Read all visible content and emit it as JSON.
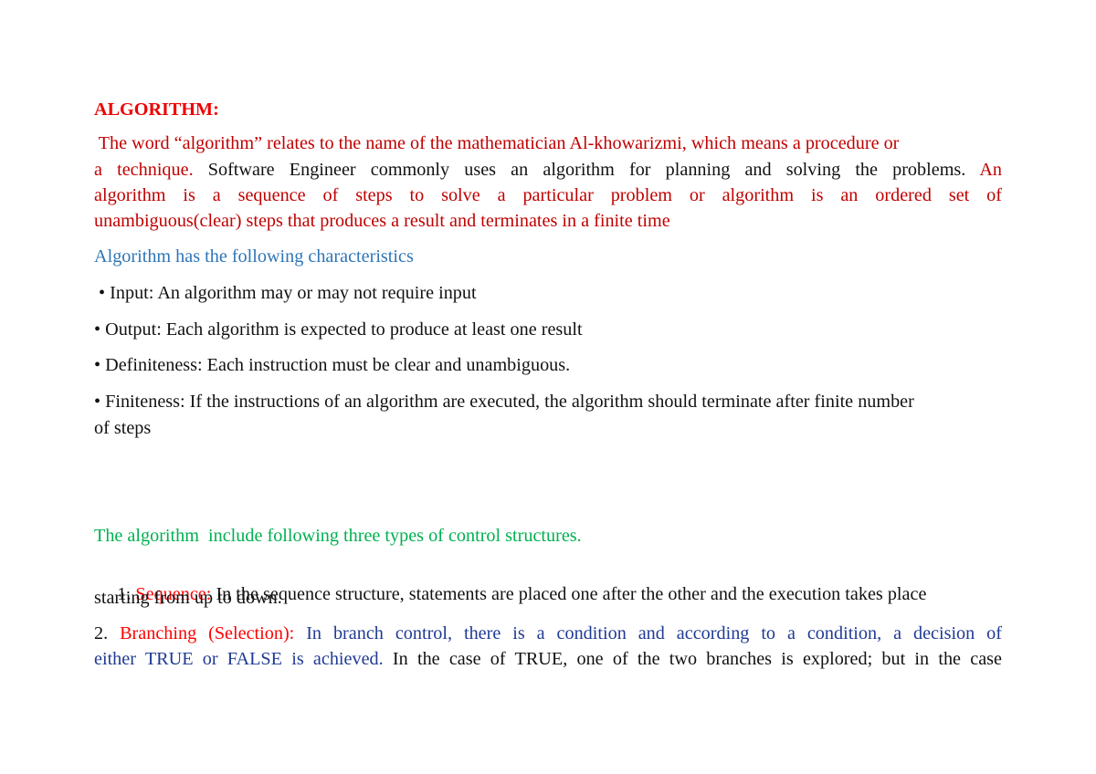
{
  "document": {
    "title": "ALGORITHM:",
    "intro": {
      "line1": " The word “algorithm” relates to the name of the mathematician Al-khowarizmi, which means a procedure or",
      "line2_red": "a technique.",
      "line2_black": " Software Engineer commonly uses an algorithm for planning and solving the problems.",
      "line2_red_end": " An",
      "line3": "algorithm is a sequence of steps to solve a particular problem or algorithm is an ordered set of",
      "line4": "unambiguous(clear) steps that produces a result and terminates in a finite time"
    },
    "characteristics_heading": "Algorithm has the following characteristics",
    "characteristics": [
      " • Input: An algorithm may or may not require input",
      "• Output: Each algorithm is expected to produce at least one result",
      "• Definiteness: Each instruction must be clear and unambiguous.",
      "• Finiteness: If the instructions of an algorithm are executed, the algorithm should terminate after finite number"
    ],
    "characteristics_continuation": "of steps",
    "control_heading": "The algorithm  include following three types of control structures.",
    "sequence": {
      "number": " 1. ",
      "label": "Sequence:",
      "line1": " In the sequence structure, statements are placed one after the other and the execution takes place",
      "line2": "starting from up to down."
    },
    "branching": {
      "number": "2. ",
      "label": "Branching (Selection):",
      "line1": " In branch control, there is a condition and according to a condition, a decision of",
      "line2_navy": "either TRUE or FALSE is achieved.",
      "line2_black": " In the case of TRUE, one of the two branches is explored; but in the case"
    }
  }
}
